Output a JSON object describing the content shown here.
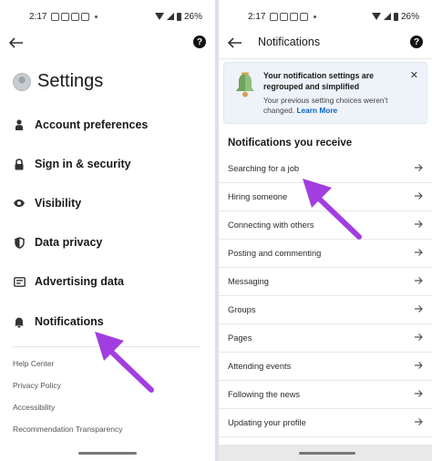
{
  "left": {
    "status": {
      "time": "2:17",
      "battery": "26%"
    },
    "header": {
      "back_label": "back",
      "help_label": "?"
    },
    "title": "Settings",
    "menu": [
      {
        "label": "Account preferences",
        "icon": "person-icon"
      },
      {
        "label": "Sign in & security",
        "icon": "lock-icon"
      },
      {
        "label": "Visibility",
        "icon": "eye-icon"
      },
      {
        "label": "Data privacy",
        "icon": "shield-icon"
      },
      {
        "label": "Advertising data",
        "icon": "ad-icon"
      },
      {
        "label": "Notifications",
        "icon": "bell-icon"
      }
    ],
    "footer_links": [
      "Help Center",
      "Privacy Policy",
      "Accessibility",
      "Recommendation Transparency"
    ]
  },
  "right": {
    "status": {
      "time": "2:17",
      "battery": "26%"
    },
    "header": {
      "title": "Notifications",
      "help_label": "?"
    },
    "banner": {
      "title": "Your notification settings are regrouped and simplified",
      "body": "Your previous setting choices weren't changed.",
      "link": "Learn More",
      "close": "✕"
    },
    "section_title": "Notifications you receive",
    "items": [
      "Searching for a job",
      "Hiring someone",
      "Connecting with others",
      "Posting and commenting",
      "Messaging",
      "Groups",
      "Pages",
      "Attending events",
      "Following the news",
      "Updating your profile"
    ]
  },
  "colors": {
    "accent_link": "#0a66c2",
    "annotation_arrow": "#a23ee0",
    "divider": "#e5dcec",
    "banner_bg": "#edf3f8"
  }
}
